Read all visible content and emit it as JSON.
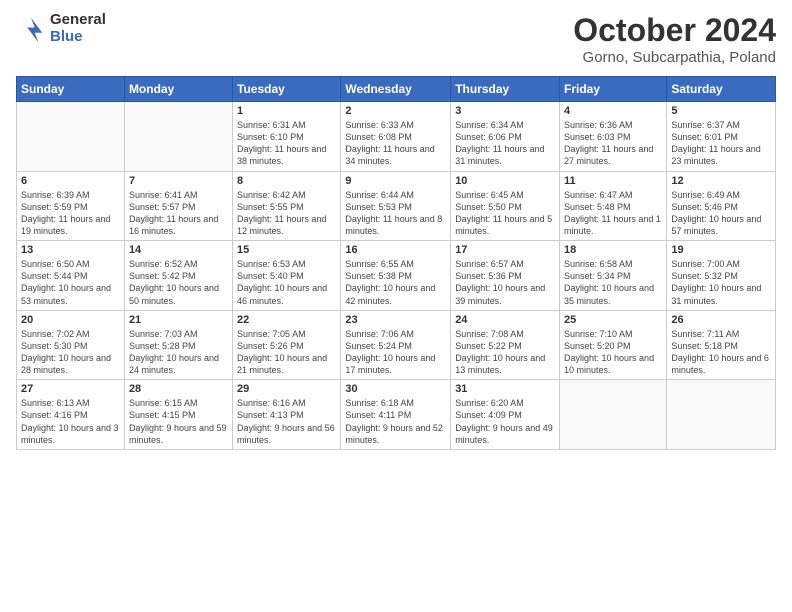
{
  "header": {
    "logo_general": "General",
    "logo_blue": "Blue",
    "month_title": "October 2024",
    "location": "Gorno, Subcarpathia, Poland"
  },
  "days_of_week": [
    "Sunday",
    "Monday",
    "Tuesday",
    "Wednesday",
    "Thursday",
    "Friday",
    "Saturday"
  ],
  "weeks": [
    [
      {
        "day": "",
        "info": ""
      },
      {
        "day": "",
        "info": ""
      },
      {
        "day": "1",
        "info": "Sunrise: 6:31 AM\nSunset: 6:10 PM\nDaylight: 11 hours and 38 minutes."
      },
      {
        "day": "2",
        "info": "Sunrise: 6:33 AM\nSunset: 6:08 PM\nDaylight: 11 hours and 34 minutes."
      },
      {
        "day": "3",
        "info": "Sunrise: 6:34 AM\nSunset: 6:06 PM\nDaylight: 11 hours and 31 minutes."
      },
      {
        "day": "4",
        "info": "Sunrise: 6:36 AM\nSunset: 6:03 PM\nDaylight: 11 hours and 27 minutes."
      },
      {
        "day": "5",
        "info": "Sunrise: 6:37 AM\nSunset: 6:01 PM\nDaylight: 11 hours and 23 minutes."
      }
    ],
    [
      {
        "day": "6",
        "info": "Sunrise: 6:39 AM\nSunset: 5:59 PM\nDaylight: 11 hours and 19 minutes."
      },
      {
        "day": "7",
        "info": "Sunrise: 6:41 AM\nSunset: 5:57 PM\nDaylight: 11 hours and 16 minutes."
      },
      {
        "day": "8",
        "info": "Sunrise: 6:42 AM\nSunset: 5:55 PM\nDaylight: 11 hours and 12 minutes."
      },
      {
        "day": "9",
        "info": "Sunrise: 6:44 AM\nSunset: 5:53 PM\nDaylight: 11 hours and 8 minutes."
      },
      {
        "day": "10",
        "info": "Sunrise: 6:45 AM\nSunset: 5:50 PM\nDaylight: 11 hours and 5 minutes."
      },
      {
        "day": "11",
        "info": "Sunrise: 6:47 AM\nSunset: 5:48 PM\nDaylight: 11 hours and 1 minute."
      },
      {
        "day": "12",
        "info": "Sunrise: 6:49 AM\nSunset: 5:46 PM\nDaylight: 10 hours and 57 minutes."
      }
    ],
    [
      {
        "day": "13",
        "info": "Sunrise: 6:50 AM\nSunset: 5:44 PM\nDaylight: 10 hours and 53 minutes."
      },
      {
        "day": "14",
        "info": "Sunrise: 6:52 AM\nSunset: 5:42 PM\nDaylight: 10 hours and 50 minutes."
      },
      {
        "day": "15",
        "info": "Sunrise: 6:53 AM\nSunset: 5:40 PM\nDaylight: 10 hours and 46 minutes."
      },
      {
        "day": "16",
        "info": "Sunrise: 6:55 AM\nSunset: 5:38 PM\nDaylight: 10 hours and 42 minutes."
      },
      {
        "day": "17",
        "info": "Sunrise: 6:57 AM\nSunset: 5:36 PM\nDaylight: 10 hours and 39 minutes."
      },
      {
        "day": "18",
        "info": "Sunrise: 6:58 AM\nSunset: 5:34 PM\nDaylight: 10 hours and 35 minutes."
      },
      {
        "day": "19",
        "info": "Sunrise: 7:00 AM\nSunset: 5:32 PM\nDaylight: 10 hours and 31 minutes."
      }
    ],
    [
      {
        "day": "20",
        "info": "Sunrise: 7:02 AM\nSunset: 5:30 PM\nDaylight: 10 hours and 28 minutes."
      },
      {
        "day": "21",
        "info": "Sunrise: 7:03 AM\nSunset: 5:28 PM\nDaylight: 10 hours and 24 minutes."
      },
      {
        "day": "22",
        "info": "Sunrise: 7:05 AM\nSunset: 5:26 PM\nDaylight: 10 hours and 21 minutes."
      },
      {
        "day": "23",
        "info": "Sunrise: 7:06 AM\nSunset: 5:24 PM\nDaylight: 10 hours and 17 minutes."
      },
      {
        "day": "24",
        "info": "Sunrise: 7:08 AM\nSunset: 5:22 PM\nDaylight: 10 hours and 13 minutes."
      },
      {
        "day": "25",
        "info": "Sunrise: 7:10 AM\nSunset: 5:20 PM\nDaylight: 10 hours and 10 minutes."
      },
      {
        "day": "26",
        "info": "Sunrise: 7:11 AM\nSunset: 5:18 PM\nDaylight: 10 hours and 6 minutes."
      }
    ],
    [
      {
        "day": "27",
        "info": "Sunrise: 6:13 AM\nSunset: 4:16 PM\nDaylight: 10 hours and 3 minutes."
      },
      {
        "day": "28",
        "info": "Sunrise: 6:15 AM\nSunset: 4:15 PM\nDaylight: 9 hours and 59 minutes."
      },
      {
        "day": "29",
        "info": "Sunrise: 6:16 AM\nSunset: 4:13 PM\nDaylight: 9 hours and 56 minutes."
      },
      {
        "day": "30",
        "info": "Sunrise: 6:18 AM\nSunset: 4:11 PM\nDaylight: 9 hours and 52 minutes."
      },
      {
        "day": "31",
        "info": "Sunrise: 6:20 AM\nSunset: 4:09 PM\nDaylight: 9 hours and 49 minutes."
      },
      {
        "day": "",
        "info": ""
      },
      {
        "day": "",
        "info": ""
      }
    ]
  ]
}
